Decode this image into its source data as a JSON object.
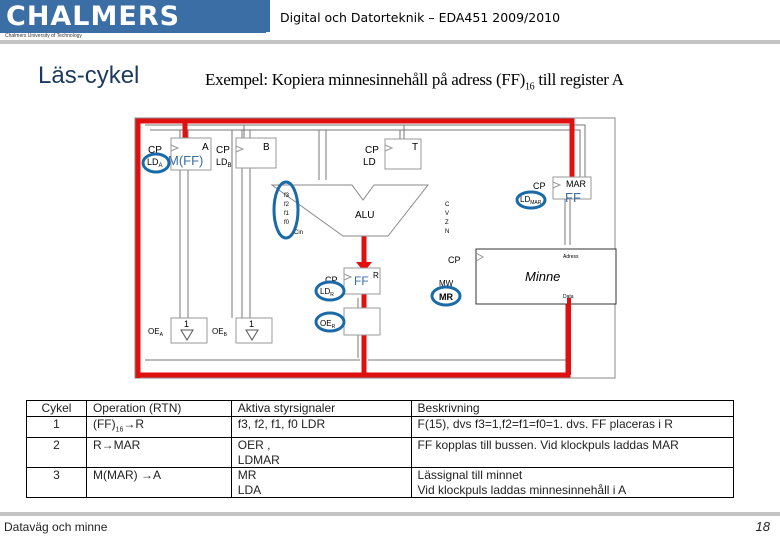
{
  "header": {
    "logo": "CHALMERS",
    "logo_subtitle": "Chalmers University of Technology",
    "course_title": "Digital och Datorteknik – EDA451 2009/2010"
  },
  "slide": {
    "title": "Läs-cykel",
    "subtitle_main": "Exempel: Kopiera minnesinnehåll på adress (FF)",
    "subtitle_sub": "16",
    "subtitle_tail": " till register A"
  },
  "diagram": {
    "colors": {
      "bus_path": "#e01010",
      "highlight": "#1a6aa8",
      "wire": "#555555",
      "value": "#3a6ea5"
    },
    "register_a": {
      "label": "A",
      "cp": "CP",
      "ld": "LD",
      "ld_sub": "A",
      "value": "M(FF)"
    },
    "register_b": {
      "label": "B",
      "cp": "CP",
      "ld": "LD",
      "ld_sub": "B"
    },
    "register_t": {
      "label": "T",
      "cp": "CP",
      "ld": "LD"
    },
    "alu": {
      "label": "ALU",
      "inputs": [
        "f3",
        "f2",
        "f1",
        "f0",
        "Cin"
      ],
      "flags": [
        "C",
        "V",
        "Z",
        "N"
      ]
    },
    "register_mar": {
      "label": "MAR",
      "cp": "CP",
      "ld": "LD",
      "ld_sub": "MAR",
      "value": "FF"
    },
    "register_r": {
      "label": "R",
      "cp": "CP",
      "ld": "LD",
      "ld_sub": "R",
      "value": "FF",
      "oe": "OE",
      "oe_sub": "R"
    },
    "buffer_a": {
      "label": "1",
      "oe": "OE",
      "oe_sub": "A"
    },
    "buffer_b": {
      "label": "1",
      "oe": "OE",
      "oe_sub": "B"
    },
    "memory": {
      "label": "Minne",
      "cp": "CP",
      "mw": "MW",
      "mr": "MR",
      "address": "Adress",
      "data": "Data"
    }
  },
  "table": {
    "headers": [
      "Cykel",
      "Operation (RTN)",
      "Aktiva styrsignaler",
      "Beskrivning"
    ],
    "rows": [
      {
        "cycle": "1",
        "operation": "(FF)",
        "operation_sub": "16",
        "operation_tail": "→R",
        "signals_line1": "f3, f2, f1, f0 LDR",
        "signals_line2": "",
        "description_line1": "F(15), dvs f3=1,f2=f1=f0=1. dvs. FF placeras i R",
        "description_line2": ""
      },
      {
        "cycle": "2",
        "operation": "R→MAR",
        "operation_sub": "",
        "operation_tail": "",
        "signals_line1": "OER ,",
        "signals_line2": "LDMAR",
        "description_line1": "FF kopplas till bussen. Vid klockpuls laddas MAR",
        "description_line2": ""
      },
      {
        "cycle": "3",
        "operation": "M(MAR) →A",
        "operation_sub": "",
        "operation_tail": "",
        "signals_line1": "MR",
        "signals_line2": "LDA",
        "description_line1": "Lässignal till minnet",
        "description_line2": "Vid klockpuls laddas minnesinnehåll i A"
      }
    ]
  },
  "footer": {
    "section": "Dataväg och minne",
    "page_number": "18"
  }
}
